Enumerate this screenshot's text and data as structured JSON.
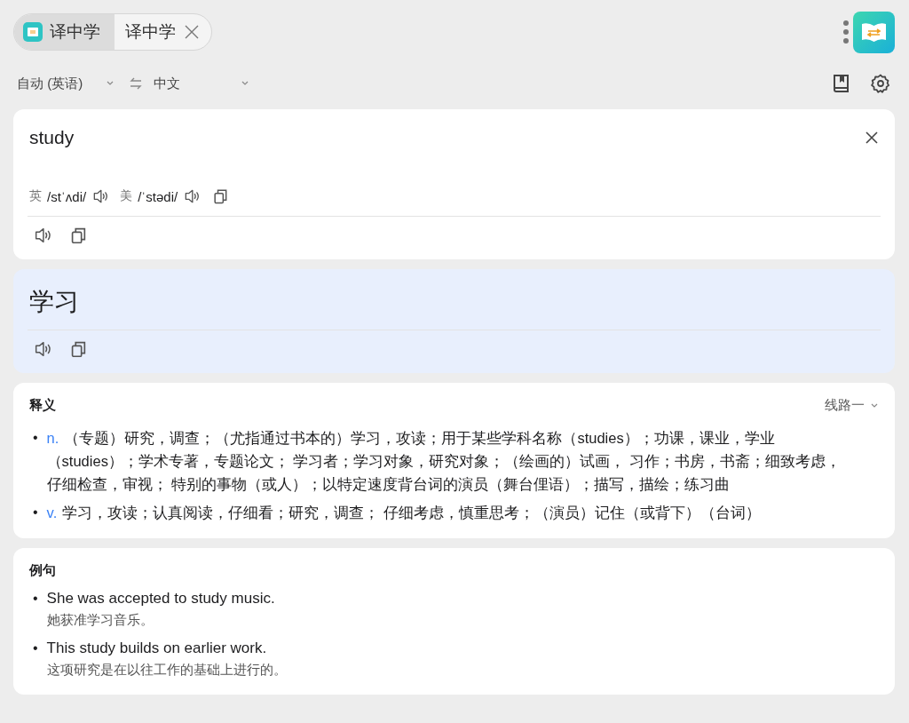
{
  "tabs": [
    {
      "label": "译中学",
      "selected": true,
      "kind": "app"
    },
    {
      "label": "译中学",
      "selected": false,
      "kind": "closable"
    }
  ],
  "languages": {
    "source": "自动 (英语)",
    "target": "中文"
  },
  "source": {
    "text": "study",
    "phonetics": [
      {
        "region": "英",
        "ipa": "/stˈʌdi/"
      },
      {
        "region": "美",
        "ipa": "/ˈstədi/"
      }
    ]
  },
  "translation": {
    "text": "学习"
  },
  "definitions": {
    "title": "释义",
    "route": "线路一",
    "items": [
      {
        "marker": "•",
        "pos": "n.",
        "text": "（专题）研究，调查；（尤指通过书本的）学习，攻读；用于某些学科名称（studies）；功课，课业，学业（studies）；学术专著，专题论文； 学习者；学习对象，研究对象；（绘画的）试画， 习作；书房，书斋；细致考虑，仔细检查，审视； 特别的事物（或人）；以特定速度背台词的演员（舞台俚语）；描写，描绘；练习曲"
      },
      {
        "marker": "•",
        "pos": "v.",
        "text": "学习，攻读；认真阅读，仔细看；研究，调查； 仔细考虑，慎重思考；（演员）记住（或背下）（台词）"
      }
    ]
  },
  "examples": {
    "title": "例句",
    "items": [
      {
        "marker": "•",
        "en": "She was accepted to study music.",
        "zh": "她获准学习音乐。"
      },
      {
        "marker": "•",
        "en": "This study builds on earlier work.",
        "zh": "这项研究是在以往工作的基础上进行的。"
      }
    ]
  }
}
